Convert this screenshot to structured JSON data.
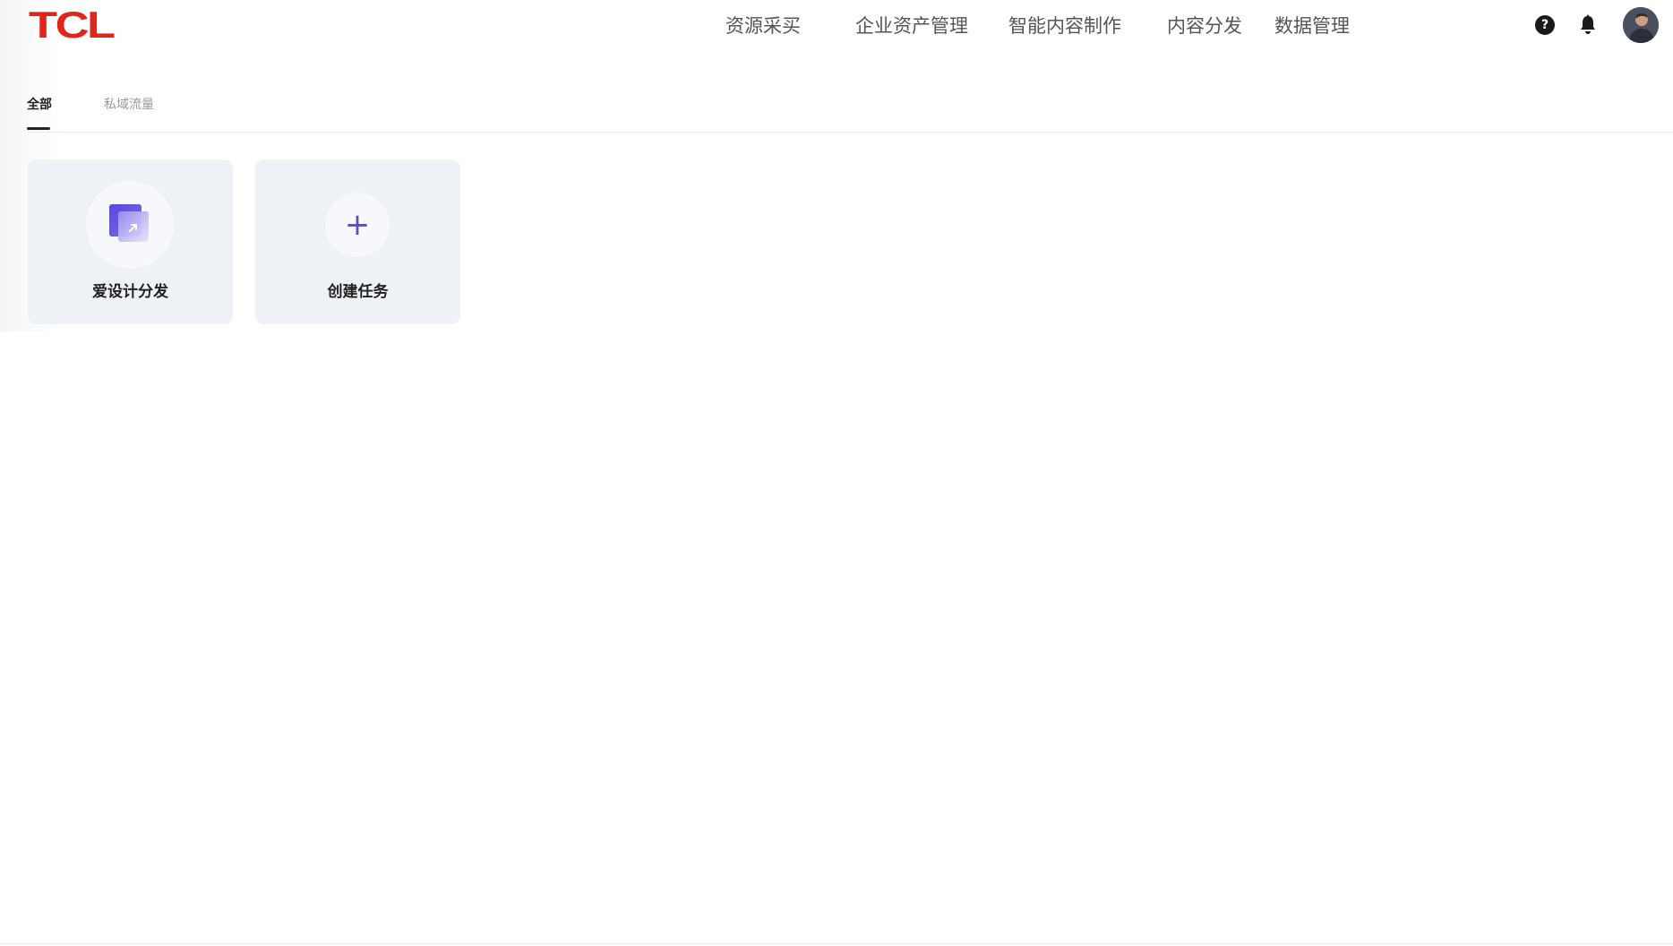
{
  "brand": {
    "logo_text": "TCL",
    "color": "#e1251b"
  },
  "nav": {
    "items": [
      {
        "label": "资源采买"
      },
      {
        "label": "企业资产管理"
      },
      {
        "label": "智能内容制作"
      },
      {
        "label": "内容分发"
      },
      {
        "label": "数据管理"
      }
    ]
  },
  "header_actions": {
    "help_icon": "question-circle-icon",
    "help_glyph": "?",
    "notification_icon": "bell-icon",
    "avatar": "user-avatar"
  },
  "tabs": [
    {
      "label": "全部",
      "active": true
    },
    {
      "label": "私域流量",
      "active": false
    }
  ],
  "cards": [
    {
      "label": "爱设计分发",
      "icon": "share-app-icon",
      "accent": "#6a5be0"
    },
    {
      "label": "创建任务",
      "icon": "plus-icon",
      "glyph": "+",
      "accent": "#5b4fb5"
    }
  ]
}
